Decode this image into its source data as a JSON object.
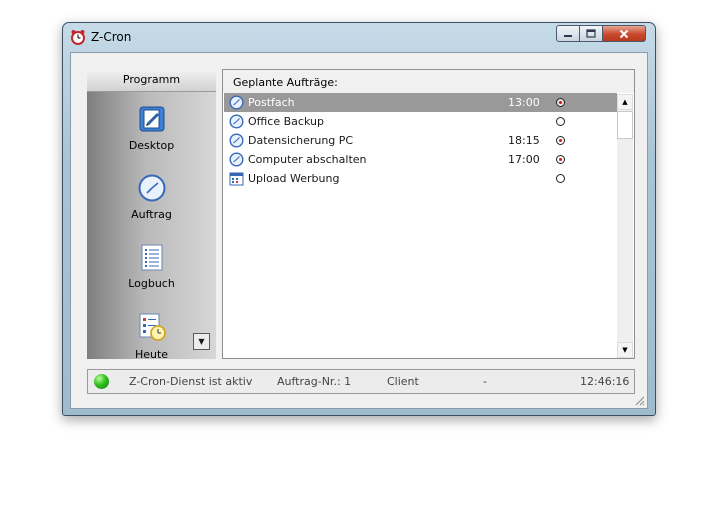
{
  "window": {
    "title": "Z-Cron",
    "buttons": {
      "minimize": "–",
      "maximize": "□",
      "close": "✕"
    }
  },
  "sidebar": {
    "header": "Programm",
    "items": [
      {
        "label": "Desktop",
        "icon": "desktop-icon"
      },
      {
        "label": "Auftrag",
        "icon": "clock-icon"
      },
      {
        "label": "Logbuch",
        "icon": "list-icon"
      },
      {
        "label": "Heute",
        "icon": "calendar-clock-icon"
      }
    ],
    "scroll_arrow": "▼"
  },
  "jobs": {
    "header": "Geplante Aufträge:",
    "rows": [
      {
        "name": "Postfach",
        "time": "13:00",
        "active": true,
        "selected": true,
        "icon": "clock-icon"
      },
      {
        "name": "Office Backup",
        "time": "",
        "active": false,
        "selected": false,
        "icon": "clock-icon"
      },
      {
        "name": "Datensicherung PC",
        "time": "18:15",
        "active": true,
        "selected": false,
        "icon": "clock-icon"
      },
      {
        "name": "Computer abschalten",
        "time": "17:00",
        "active": true,
        "selected": false,
        "icon": "clock-icon"
      },
      {
        "name": "Upload Werbung",
        "time": "",
        "active": false,
        "selected": false,
        "icon": "calendar-icon"
      }
    ],
    "scroll_up": "▲",
    "scroll_down": "▼"
  },
  "status": {
    "service": "Z-Cron-Dienst ist aktiv",
    "job_number": "Auftrag-Nr.: 1",
    "mode": "Client",
    "separator": "-",
    "clock": "12:46:16",
    "led_color": "#2fc21d"
  },
  "colors": {
    "selection": "#999999",
    "radio_active": "#d01818"
  }
}
